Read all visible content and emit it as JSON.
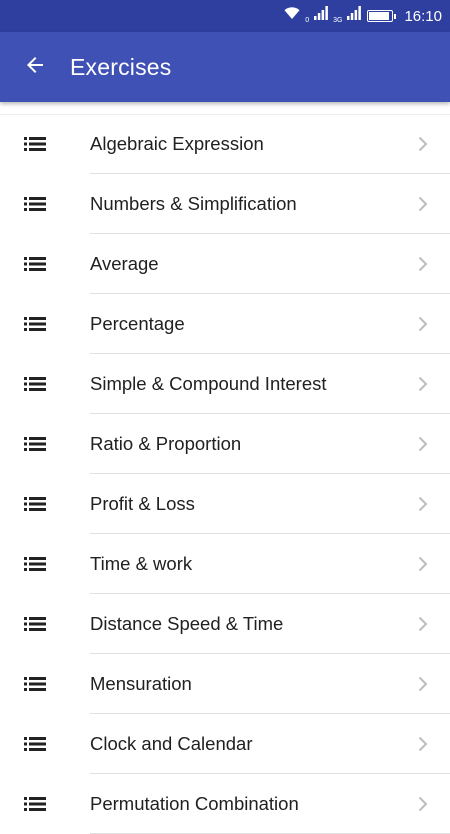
{
  "status_bar": {
    "time": "16:10",
    "signal_1_label": "0",
    "signal_2_label": "3G",
    "battery_level": 0.9
  },
  "app_bar": {
    "title": "Exercises",
    "back_icon": "arrow-back-icon"
  },
  "colors": {
    "status_bar": "#2f3fa0",
    "app_bar": "#3f51b5",
    "text": "#212121",
    "chevron": "#bdbdbd"
  },
  "exercises": [
    {
      "label": "Algebraic Expression"
    },
    {
      "label": "Numbers & Simplification"
    },
    {
      "label": "Average"
    },
    {
      "label": "Percentage"
    },
    {
      "label": "Simple & Compound Interest"
    },
    {
      "label": "Ratio & Proportion"
    },
    {
      "label": "Profit & Loss"
    },
    {
      "label": "Time & work"
    },
    {
      "label": "Distance Speed & Time"
    },
    {
      "label": "Mensuration"
    },
    {
      "label": "Clock and Calendar"
    },
    {
      "label": "Permutation Combination"
    }
  ]
}
